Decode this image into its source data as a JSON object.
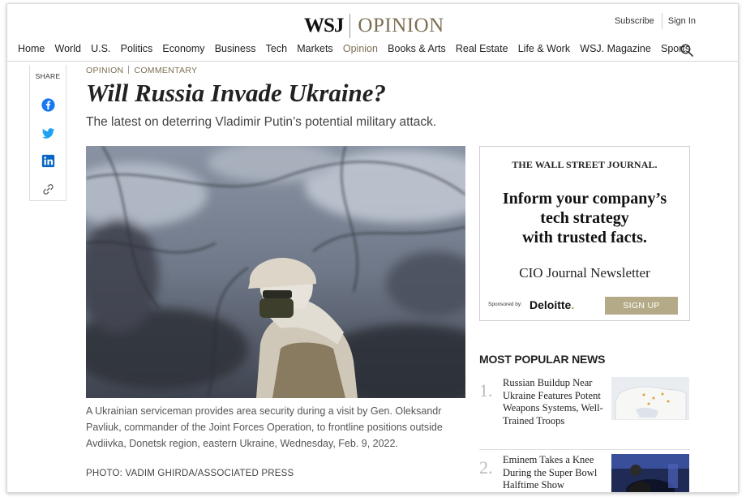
{
  "masthead": {
    "logo_wsj": "WSJ",
    "logo_section": "OPINION",
    "subscribe_label": "Subscribe",
    "signin_label": "Sign In"
  },
  "nav": {
    "items": [
      "Home",
      "World",
      "U.S.",
      "Politics",
      "Economy",
      "Business",
      "Tech",
      "Markets",
      "Opinion",
      "Books & Arts",
      "Real Estate",
      "Life & Work",
      "WSJ. Magazine",
      "Sports"
    ],
    "active": "Opinion",
    "search_icon": "search-icon"
  },
  "share": {
    "label": "SHARE",
    "icons": [
      "facebook-icon",
      "twitter-icon",
      "linkedin-icon",
      "link-icon"
    ]
  },
  "article": {
    "section": "OPINION",
    "category": "COMMENTARY",
    "headline": "Will Russia Invade Ukraine?",
    "dek": "The latest on deterring Vladimir Putin’s potential military attack.",
    "caption": "A Ukrainian serviceman provides area security during a visit by Gen. Oleksandr Pavliuk, commander of the Joint Forces Operation, to frontline positions outside Avdiivka, Donetsk region, eastern Ukraine, Wednesday, Feb. 9, 2022.",
    "credit": "PHOTO: VADIM GHIRDA/ASSOCIATED PRESS"
  },
  "ad": {
    "brand": "THE WALL STREET JOURNAL.",
    "headline_lines": [
      "Inform your company’s",
      "tech strategy",
      "with trusted facts."
    ],
    "newsletter": "CIO Journal Newsletter",
    "sponsored_by": "Sponsored by:",
    "sponsor_name": "Deloitte",
    "sponsor_dot": ".",
    "cta": "SIGN UP"
  },
  "most_popular": {
    "title": "MOST POPULAR NEWS",
    "items": [
      {
        "num": "1.",
        "title": "Russian Buildup Near Ukraine Features Potent Weapons Systems, Well-Trained Troops"
      },
      {
        "num": "2.",
        "title": "Eminem Takes a Knee During the Super Bowl Halftime Show"
      }
    ]
  },
  "colors": {
    "opinion_accent": "#7d6f54",
    "facebook": "#1877f2",
    "twitter": "#1da1f2",
    "linkedin": "#0a66c2",
    "signup_button": "#b5aa88",
    "deloitte_dot": "#86bc25"
  }
}
